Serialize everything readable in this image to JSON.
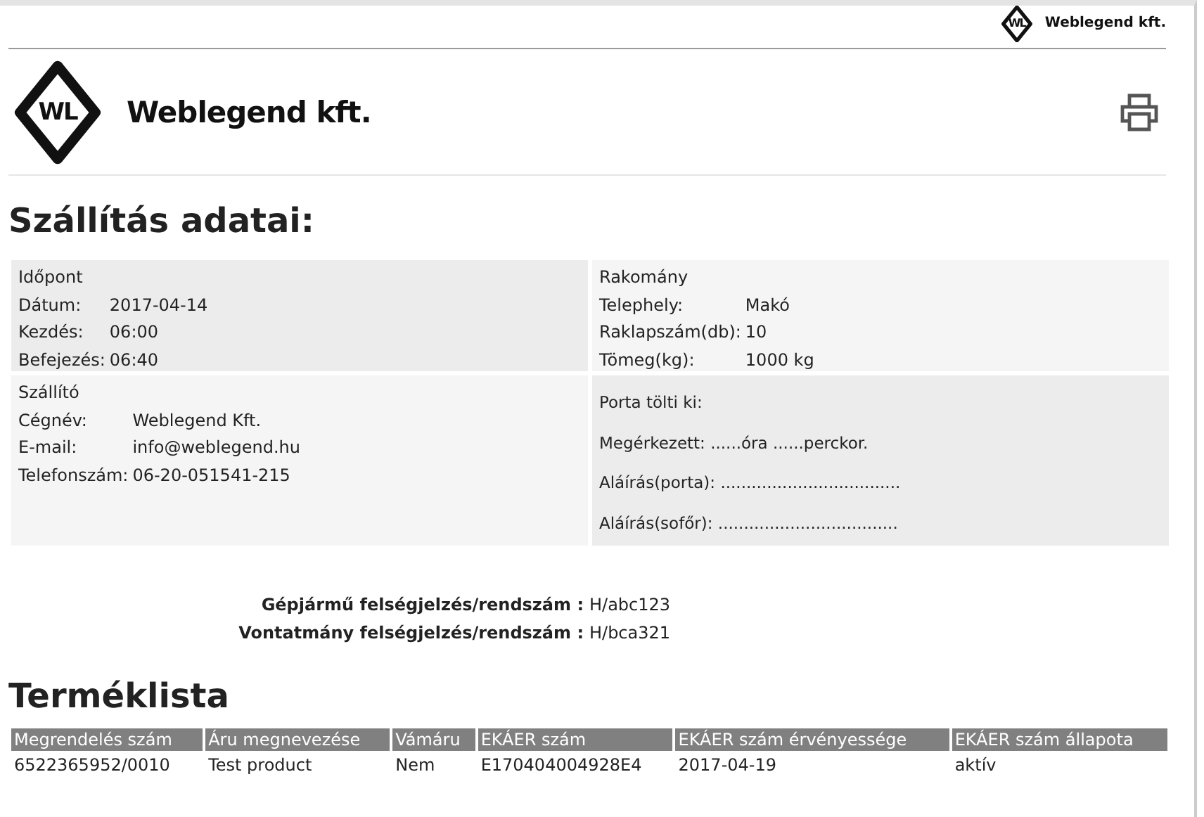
{
  "top_logo": {
    "mark": "WL",
    "name": "Weblegend kft."
  },
  "header_logo": {
    "mark": "WL",
    "name": "Weblegend kft."
  },
  "title": "Szállítás adatai:",
  "panels": [
    {
      "kind": "fields",
      "heading": "Időpont",
      "rows": [
        {
          "label": "Dátum:",
          "value": "2017-04-14"
        },
        {
          "label": "Kezdés:",
          "value": "06:00"
        },
        {
          "label": "Befejezés:",
          "value": "06:40"
        }
      ]
    },
    {
      "kind": "fields",
      "heading": "Rakomány",
      "rows": [
        {
          "label": "Telephely:",
          "value": "Makó"
        },
        {
          "label": "Raklapszám(db):",
          "value": "10"
        },
        {
          "label": "Tömeg(kg):",
          "value": "1000 kg"
        }
      ]
    },
    {
      "kind": "fields",
      "heading": "Szállító",
      "rows": [
        {
          "label": "Cégnév:",
          "value": "Weblegend Kft."
        },
        {
          "label": "E-mail:",
          "value": "info@weblegend.hu"
        },
        {
          "label": "Telefonszám:",
          "value": "06-20-051541-215"
        }
      ]
    },
    {
      "kind": "lines",
      "lines": [
        "Porta tölti ki:",
        "Megérkezett: ......óra ......perckor.",
        "Aláírás(porta): ...................................",
        "Aláírás(sofőr): ..................................."
      ]
    }
  ],
  "vehicles": [
    {
      "label": "Gépjármű felségjelzés/rendszám :",
      "value": "H/abc123"
    },
    {
      "label": "Vontatmány felségjelzés/rendszám :",
      "value": "H/bca321"
    }
  ],
  "products": {
    "title": "Terméklista",
    "columns": [
      "Megrendelés szám",
      "Áru megnevezése",
      "Vámáru",
      "EKÁER szám",
      "EKÁER szám érvényessége",
      "EKÁER szám állapota"
    ],
    "rows": [
      [
        "6522365952/0010",
        "Test product",
        "Nem",
        "E170404004928E4",
        "2017-04-19",
        "aktív"
      ]
    ]
  }
}
